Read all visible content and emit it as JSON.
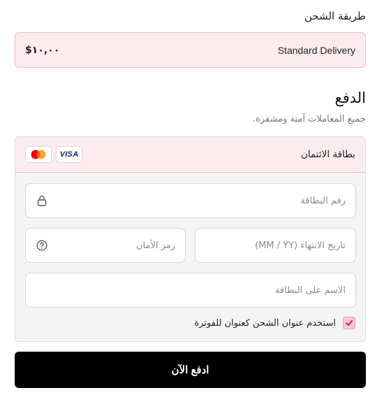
{
  "shipping": {
    "title": "طريقة الشحن",
    "option_name": "Standard Delivery",
    "option_price": "$١٠,٠٠"
  },
  "payment": {
    "title": "الدفع",
    "subtitle": "جميع المعاملات آمنة ومشفرة.",
    "method_label": "بطاقة الائتمان",
    "brands": [
      "visa-logo",
      "mastercard-logo"
    ],
    "visa_text": "VISA",
    "fields": {
      "card_number_placeholder": "رقم البطاقة",
      "expiry_placeholder": "تاريخ الانتهاء (MM / YY)",
      "cvv_placeholder": "رمز الأمان",
      "name_placeholder": "الاسم على البطاقة"
    },
    "billing_checkbox": {
      "label": "استخدم عنوان الشحن كعنوان للفوترة",
      "checked": true
    },
    "pay_button_label": "ادفع الآن"
  },
  "colors": {
    "accent_bg": "#fdecef",
    "accent_border": "#f2b7c0",
    "checkbox_fill": "#f9c7cf",
    "checkmark": "#c2185b",
    "button_bg": "#000000"
  }
}
